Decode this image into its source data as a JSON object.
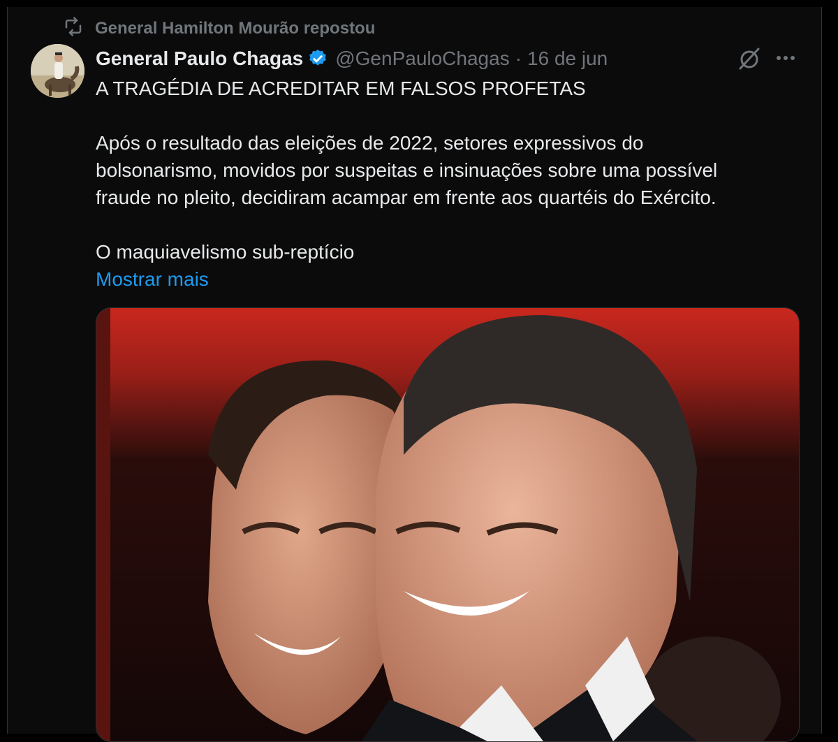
{
  "repost": {
    "text": "General Hamilton Mourão repostou",
    "icon": "repost-icon"
  },
  "tweet": {
    "author_name": "General Paulo Chagas",
    "verified": true,
    "handle": "@GenPauloChagas",
    "separator": "·",
    "date": "16 de jun",
    "lines": [
      "A TRAGÉDIA DE ACREDITAR EM FALSOS PROFETAS",
      "Após o resultado das eleições de 2022, setores expressivos do",
      "bolsonarismo, movidos por suspeitas e insinuações sobre uma possível",
      "fraude no pleito, decidiram acampar em frente aos quartéis do Exército.",
      "O maquiavelismo sub-reptício"
    ],
    "show_more": "Mostrar mais"
  },
  "icons": {
    "verified": "verified-badge-icon",
    "grok": "grok-icon",
    "more": "more-options-icon"
  },
  "colors": {
    "background": "#000000",
    "text": "#e7e9ea",
    "muted": "#71767b",
    "link": "#1d9bf0",
    "verified": "#1d9bf0"
  }
}
